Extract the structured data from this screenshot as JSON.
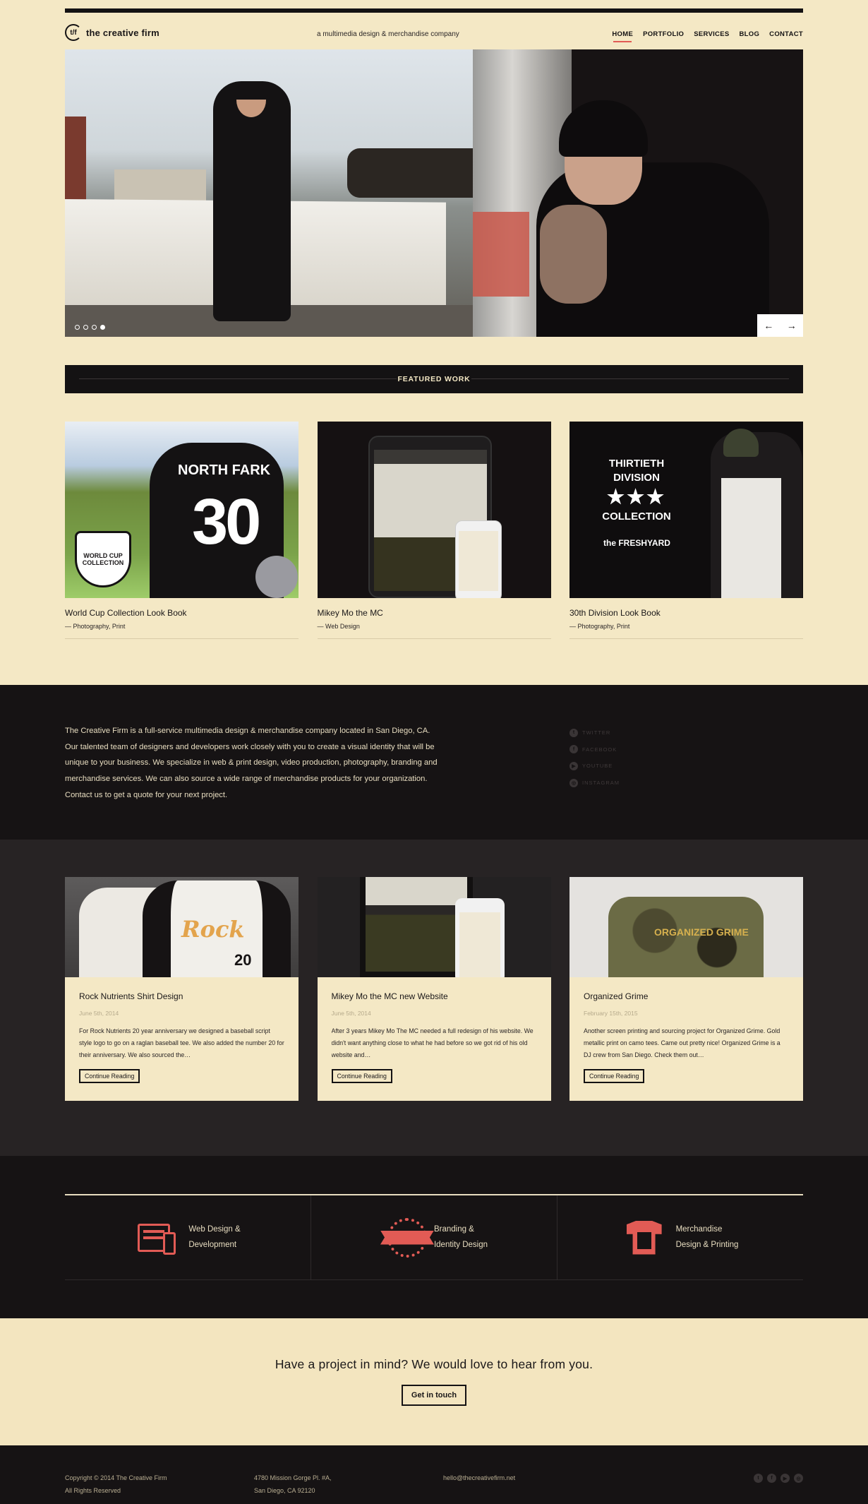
{
  "header": {
    "logo_mark": "t/f",
    "logo_text": "the creative firm",
    "tagline": "a multimedia design & merchandise company",
    "nav": [
      "HOME",
      "PORTFOLIO",
      "SERVICES",
      "BLOG",
      "CONTACT"
    ],
    "nav_active": "HOME"
  },
  "hero": {
    "slides_count": 4,
    "active_slide": 1,
    "prev_icon": "arrow-left-icon",
    "next_icon": "arrow-right-icon",
    "prev_glyph": "←",
    "next_glyph": "→"
  },
  "featured": {
    "heading": "FEATURED WORK",
    "items": [
      {
        "title": "World Cup Collection Look Book",
        "category": "Photography, Print",
        "thumb_name": "NORTH FARK",
        "thumb_number": "30",
        "thumb_badge": "WORLD CUP COLLECTION"
      },
      {
        "title": "Mikey Mo the MC",
        "category": "Web Design"
      },
      {
        "title": "30th Division Look Book",
        "category": "Photography, Print",
        "thumb_label": "THIRTIETH DIVISION",
        "thumb_stars": "★★★",
        "thumb_label2": "COLLECTION",
        "thumb_brand": "the FRESHYARD"
      }
    ],
    "dash": "—"
  },
  "about": {
    "text": "The Creative Firm is a full-service multimedia design & merchandise company located in San Diego, CA. Our talented team of designers and developers work closely with you to create a visual identity that will be unique to your business. We specialize in web & print design, video production, photography, branding and merchandise services. We can also source a wide range of merchandise products for your organization. Contact us to get a quote for your next project.",
    "social": [
      {
        "label": "TWITTER",
        "icon": "twitter-icon",
        "glyph": "t"
      },
      {
        "label": "FACEBOOK",
        "icon": "facebook-icon",
        "glyph": "f"
      },
      {
        "label": "YOUTUBE",
        "icon": "youtube-icon",
        "glyph": "▶"
      },
      {
        "label": "INSTAGRAM",
        "icon": "instagram-icon",
        "glyph": "◎"
      }
    ]
  },
  "blog": {
    "posts": [
      {
        "title": "Rock Nutrients Shirt Design",
        "date": "June 5th, 2014",
        "excerpt": "For Rock Nutrients 20 year anniversary we designed a baseball script style logo to go on a raglan baseball tee. We also added the number 20 for their anniversary. We also sourced the…",
        "button": "Continue Reading",
        "thumb_text": "Rock",
        "thumb_number": "20"
      },
      {
        "title": "Mikey Mo the MC new Website",
        "date": "June 5th, 2014",
        "excerpt": "After 3 years Mikey Mo The MC needed a full redesign of his website. We didn't want anything close to what he had before so we got rid of his old website and…",
        "button": "Continue Reading"
      },
      {
        "title": "Organized Grime",
        "date": "February 15th, 2015",
        "excerpt": "Another screen printing and sourcing project for Organized Grime. Gold metallic print on camo tees. Came out pretty nice! Organized Grime is a DJ crew from San Diego. Check them out…",
        "button": "Continue Reading",
        "thumb_text": "ORGANIZED GRIME"
      }
    ]
  },
  "services": [
    {
      "line1": "Web Design &",
      "line2": "Development",
      "icon": "web-design-icon"
    },
    {
      "line1": "Branding &",
      "line2": "Identity Design",
      "icon": "branding-badge-icon"
    },
    {
      "line1": "Merchandise",
      "line2": "Design & Printing",
      "icon": "tshirt-icon"
    }
  ],
  "cta": {
    "title": "Have a project in mind? We would love to hear from you.",
    "button": "Get in touch"
  },
  "footer": {
    "copyright": "Copyright © 2014 The Creative Firm",
    "rights": "All Rights Reserved",
    "address1": "4780 Mission Gorge Pl. #A,",
    "address2": "San Diego, CA 92120",
    "email": "hello@thecreativefirm.net",
    "icons": [
      {
        "icon": "twitter-icon",
        "glyph": "t"
      },
      {
        "icon": "facebook-icon",
        "glyph": "f"
      },
      {
        "icon": "youtube-icon",
        "glyph": "▶"
      },
      {
        "icon": "instagram-icon",
        "glyph": "◎"
      }
    ]
  },
  "colors": {
    "background": "#f4e8c5",
    "dark": "#161314",
    "accent": "#e25b55"
  }
}
